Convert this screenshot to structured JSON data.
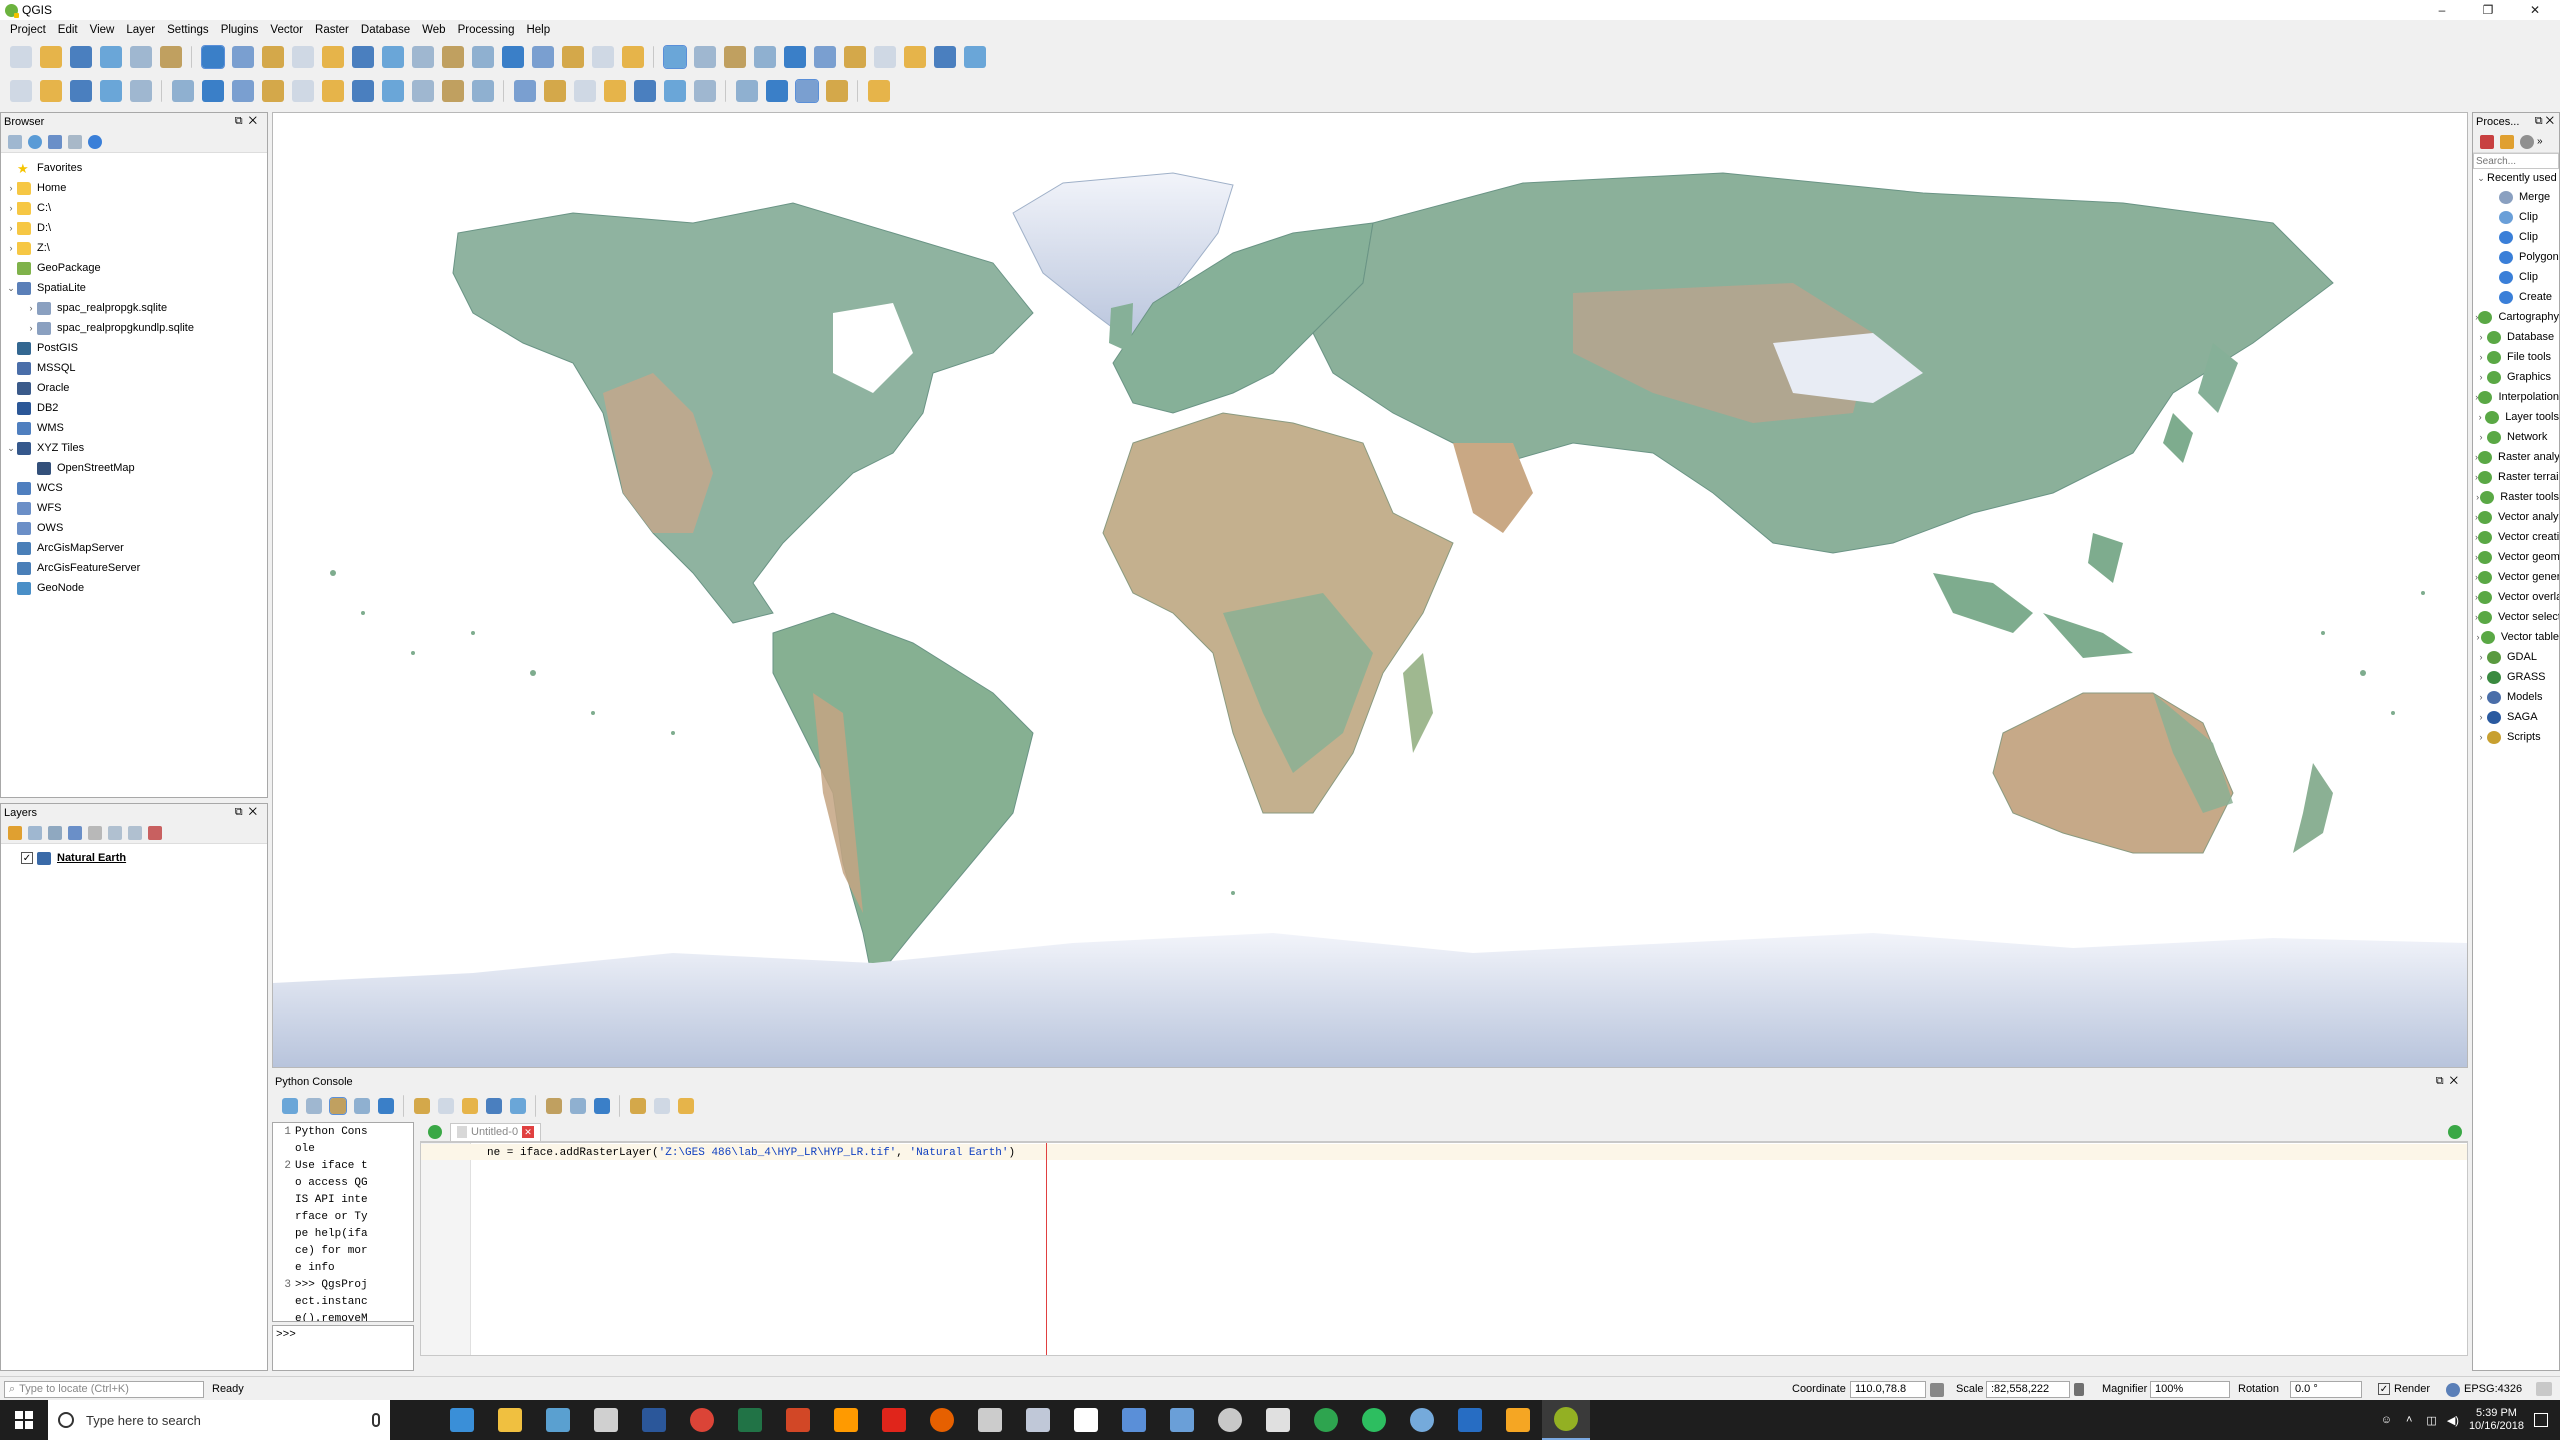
{
  "window": {
    "title": "QGIS",
    "minimize": "–",
    "maximize": "❐",
    "close": "✕"
  },
  "menu": [
    "Project",
    "Edit",
    "View",
    "Layer",
    "Settings",
    "Plugins",
    "Vector",
    "Raster",
    "Database",
    "Web",
    "Processing",
    "Help"
  ],
  "browser": {
    "title": "Browser",
    "items": [
      {
        "label": "Favorites",
        "icon": "star-icon",
        "arrow": "",
        "indent": 0,
        "color": "#f5c400"
      },
      {
        "label": "Home",
        "icon": "folder-icon",
        "arrow": "›",
        "indent": 0,
        "color": "#f6c744"
      },
      {
        "label": "C:\\",
        "icon": "folder-icon",
        "arrow": "›",
        "indent": 0,
        "color": "#f6c744"
      },
      {
        "label": "D:\\",
        "icon": "folder-icon",
        "arrow": "›",
        "indent": 0,
        "color": "#f6c744"
      },
      {
        "label": "Z:\\",
        "icon": "folder-icon",
        "arrow": "›",
        "indent": 0,
        "color": "#f6c744"
      },
      {
        "label": "GeoPackage",
        "icon": "geopackage-icon",
        "arrow": "",
        "indent": 0,
        "color": "#7fb24b"
      },
      {
        "label": "SpatiaLite",
        "icon": "spatialite-icon",
        "arrow": "⌄",
        "indent": 0,
        "color": "#5a7fb8"
      },
      {
        "label": "spac_realpropgk.sqlite",
        "icon": "database-icon",
        "arrow": "›",
        "indent": 1,
        "color": "#8aa0c0"
      },
      {
        "label": "spac_realpropgkundlp.sqlite",
        "icon": "database-icon",
        "arrow": "›",
        "indent": 1,
        "color": "#8aa0c0"
      },
      {
        "label": "PostGIS",
        "icon": "postgis-icon",
        "arrow": "",
        "indent": 0,
        "color": "#336791"
      },
      {
        "label": "MSSQL",
        "icon": "mssql-icon",
        "arrow": "",
        "indent": 0,
        "color": "#4a6ea9"
      },
      {
        "label": "Oracle",
        "icon": "oracle-icon",
        "arrow": "",
        "indent": 0,
        "color": "#3a5a8a"
      },
      {
        "label": "DB2",
        "icon": "db2-icon",
        "arrow": "",
        "indent": 0,
        "color": "#2b5797"
      },
      {
        "label": "WMS",
        "icon": "wms-icon",
        "arrow": "",
        "indent": 0,
        "color": "#4f7fbf"
      },
      {
        "label": "XYZ Tiles",
        "icon": "xyz-tiles-icon",
        "arrow": "⌄",
        "indent": 0,
        "color": "#35588c"
      },
      {
        "label": "OpenStreetMap",
        "icon": "tiles-icon",
        "arrow": "",
        "indent": 1,
        "color": "#33507a"
      },
      {
        "label": "WCS",
        "icon": "wcs-icon",
        "arrow": "",
        "indent": 0,
        "color": "#4f7fbf"
      },
      {
        "label": "WFS",
        "icon": "wfs-icon",
        "arrow": "",
        "indent": 0,
        "color": "#6b8fc7"
      },
      {
        "label": "OWS",
        "icon": "ows-icon",
        "arrow": "",
        "indent": 0,
        "color": "#6b8fc7"
      },
      {
        "label": "ArcGisMapServer",
        "icon": "arcgis-icon",
        "arrow": "",
        "indent": 0,
        "color": "#4a7fb8"
      },
      {
        "label": "ArcGisFeatureServer",
        "icon": "arcgis-icon",
        "arrow": "",
        "indent": 0,
        "color": "#4a7fb8"
      },
      {
        "label": "GeoNode",
        "icon": "geonode-icon",
        "arrow": "",
        "indent": 0,
        "color": "#4a8fc7"
      }
    ]
  },
  "layers": {
    "title": "Layers",
    "items": [
      {
        "label": "Natural Earth",
        "checked": true
      }
    ]
  },
  "processing": {
    "title": "Proces...",
    "search_placeholder": "Search...",
    "recent_label": "Recently used",
    "recent": [
      "Merge",
      "Clip",
      "Clip",
      "Polygonize",
      "Clip",
      "Create"
    ],
    "groups": [
      "Cartography",
      "Database",
      "File tools",
      "Graphics",
      "Interpolation",
      "Layer tools",
      "Network",
      "Raster analysis",
      "Raster terrain",
      "Raster tools",
      "Vector analysis",
      "Vector creation",
      "Vector geometry",
      "Vector general",
      "Vector overlay",
      "Vector selection",
      "Vector table",
      "GDAL",
      "GRASS",
      "Models",
      "SAGA",
      "Scripts"
    ]
  },
  "console": {
    "title": "Python Console",
    "history_lines": [
      {
        "num": "1",
        "text": "Python Cons"
      },
      {
        "num": "",
        "text": "ole"
      },
      {
        "num": "2",
        "text": "Use iface t"
      },
      {
        "num": "",
        "text": "o access QG"
      },
      {
        "num": "",
        "text": "IS API inte"
      },
      {
        "num": "",
        "text": "rface or Ty"
      },
      {
        "num": "",
        "text": "pe help(ifa"
      },
      {
        "num": "",
        "text": "ce) for mor"
      },
      {
        "num": "",
        "text": "e info"
      },
      {
        "num": "3",
        "text": ">>> QgsProj"
      },
      {
        "num": "",
        "text": "ect.instanc"
      },
      {
        "num": "",
        "text": "e().removeM"
      }
    ],
    "prompt": ">>>",
    "tab_label": "Untitled-0",
    "editor_line_num": "1",
    "code_prefix": "ne = iface.addRasterLayer(",
    "code_path": "'Z:\\GES 486\\lab_4\\HYP_LR\\HYP_LR.tif'",
    "code_sep": ", ",
    "code_name": "'Natural Earth'",
    "code_suffix": ")"
  },
  "status": {
    "locate_placeholder": "Type to locate (Ctrl+K)",
    "ready": "Ready",
    "coordinate_label": "Coordinate",
    "coordinate": "110.0,78.8",
    "scale_label": "Scale",
    "scale": ":82,558,222",
    "magnifier_label": "Magnifier",
    "magnifier": "100%",
    "rotation_label": "Rotation",
    "rotation": "0.0 °",
    "render_label": "Render",
    "epsg": "EPSG:4326"
  },
  "taskbar": {
    "search_placeholder": "Type here to search",
    "time": "5:39 PM",
    "date": "10/16/2018",
    "apps": [
      {
        "name": "taskview",
        "color": "#1e1e1e"
      },
      {
        "name": "outlook-bird",
        "color": "#3a8fd8"
      },
      {
        "name": "file-explorer",
        "color": "#f0c040"
      },
      {
        "name": "arcmap",
        "color": "#5aa0d0"
      },
      {
        "name": "magnifier",
        "color": "#d0d0d0"
      },
      {
        "name": "word",
        "color": "#2b579a"
      },
      {
        "name": "chrome",
        "color": "#db4437"
      },
      {
        "name": "excel",
        "color": "#217346"
      },
      {
        "name": "powerpoint",
        "color": "#d24726"
      },
      {
        "name": "illustrator",
        "color": "#ff9a00"
      },
      {
        "name": "acrobat",
        "color": "#e0251b"
      },
      {
        "name": "firefox",
        "color": "#e66000"
      },
      {
        "name": "vpn",
        "color": "#cccccc"
      },
      {
        "name": "snipping",
        "color": "#c0c8d8"
      },
      {
        "name": "notepad",
        "color": "#ffffff"
      },
      {
        "name": "doc",
        "color": "#5a8fd8"
      },
      {
        "name": "mail",
        "color": "#6a9fd8"
      },
      {
        "name": "camera",
        "color": "#c8c8c8"
      },
      {
        "name": "photos",
        "color": "#e0e0e0"
      },
      {
        "name": "maps",
        "color": "#2ea44f"
      },
      {
        "name": "evernote",
        "color": "#2dbe60"
      },
      {
        "name": "rstudio",
        "color": "#75aadb"
      },
      {
        "name": "r",
        "color": "#276dc3"
      },
      {
        "name": "arcgis",
        "color": "#f5a623"
      },
      {
        "name": "qgis",
        "color": "#93b023"
      }
    ]
  },
  "colors": {
    "accent": "#2b78d6",
    "code_string": "#1040c0",
    "code_default": "#000000",
    "caret_line": "#e04040"
  }
}
